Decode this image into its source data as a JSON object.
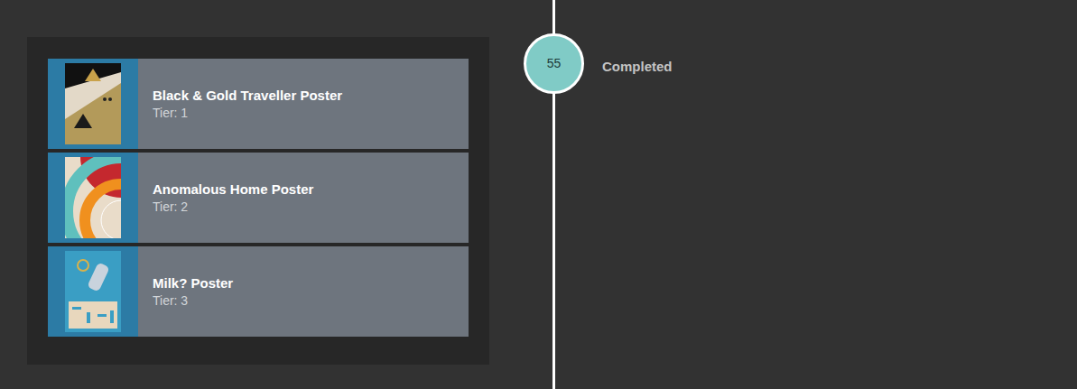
{
  "rewards": [
    {
      "name": "Black & Gold Traveller Poster",
      "tier": "Tier: 1"
    },
    {
      "name": "Anomalous Home Poster",
      "tier": "Tier: 2"
    },
    {
      "name": "Milk? Poster",
      "tier": "Tier: 3"
    }
  ],
  "level": {
    "number": "55",
    "status": "Completed"
  }
}
